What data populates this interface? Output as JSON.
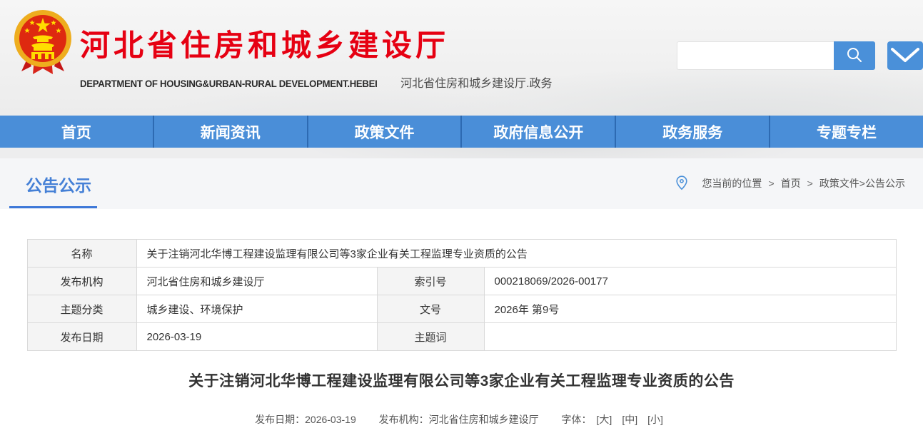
{
  "colors": {
    "accent_red": "#e60012",
    "nav_blue": "#4a8ed8",
    "link_blue": "#4580d6"
  },
  "header": {
    "site_title": "河北省住房和城乡建设厅",
    "subtitle_en": "DEPARTMENT OF HOUSING&URBAN-RURAL DEVELOPMENT.HEBEI",
    "subtitle_cn": "河北省住房和城乡建设厅.政务",
    "search": {
      "value": "",
      "placeholder": ""
    },
    "icons": {
      "emblem": "china-national-emblem",
      "search": "magnifier",
      "mail": "envelope"
    }
  },
  "nav": {
    "items": [
      "首页",
      "新闻资讯",
      "政策文件",
      "政府信息公开",
      "政务服务",
      "专题专栏"
    ]
  },
  "section_bar": {
    "tab": "公告公示",
    "breadcrumb": {
      "label": "您当前的位置",
      "separator": ">",
      "crumb_home": "首页",
      "crumb_current": "政策文件>公告公示"
    }
  },
  "info_table": {
    "rows": [
      {
        "label": "名称",
        "value": "关于注销河北华博工程建设监理有限公司等3家企业有关工程监理专业资质的公告"
      },
      {
        "label": "发布机构",
        "value": "河北省住房和城乡建设厅",
        "label2": "索引号",
        "value2": "000218069/2026-00177"
      },
      {
        "label": "主题分类",
        "value": "城乡建设、环境保护",
        "label2": "文号",
        "value2": "2026年 第9号"
      },
      {
        "label": "发布日期",
        "value": "2026-03-19",
        "label2": "主题词",
        "value2": ""
      }
    ]
  },
  "article": {
    "title": "关于注销河北华博工程建设监理有限公司等3家企业有关工程监理专业资质的公告",
    "meta": {
      "date_label": "发布日期：",
      "date": "2026-03-19",
      "org_label": "发布机构：",
      "org": "河北省住房和城乡建设厅",
      "font_label": "字体：",
      "font_large": "[大]",
      "font_medium": "[中]",
      "font_small": "[小]"
    }
  }
}
